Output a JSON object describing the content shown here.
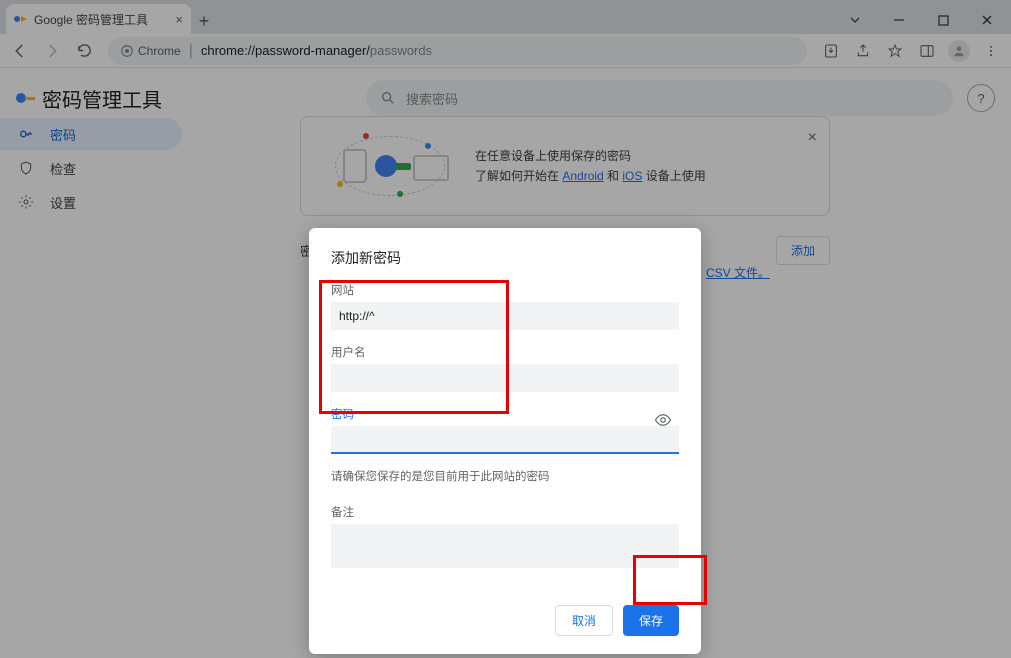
{
  "tab": {
    "title": "Google 密码管理工具"
  },
  "toolbar": {
    "secure_label": "Chrome",
    "url_host": "chrome://password-manager/",
    "url_path": "passwords"
  },
  "header": {
    "app_name": "密码管理工具",
    "search_placeholder": "搜索密码"
  },
  "sidebar": {
    "items": [
      {
        "label": "密码"
      },
      {
        "label": "检查"
      },
      {
        "label": "设置"
      }
    ]
  },
  "banner": {
    "line1": "在任意设备上使用保存的密码",
    "line2a": "了解如何开始在 ",
    "link_android": "Android",
    "line2b": " 和 ",
    "link_ios": "iOS",
    "line2c": " 设备上使用"
  },
  "bg": {
    "section_label_prefix": "密",
    "add_button": "添加",
    "csv_suffix": " CSV 文件。"
  },
  "dialog": {
    "title": "添加新密码",
    "website_label": "网站",
    "website_value": "http://^",
    "username_label": "用户名",
    "username_value": "",
    "password_label": "密码",
    "password_value": "",
    "hint": "请确保您保存的是您目前用于此网站的密码",
    "note_label": "备注",
    "note_value": "",
    "cancel": "取消",
    "save": "保存"
  }
}
